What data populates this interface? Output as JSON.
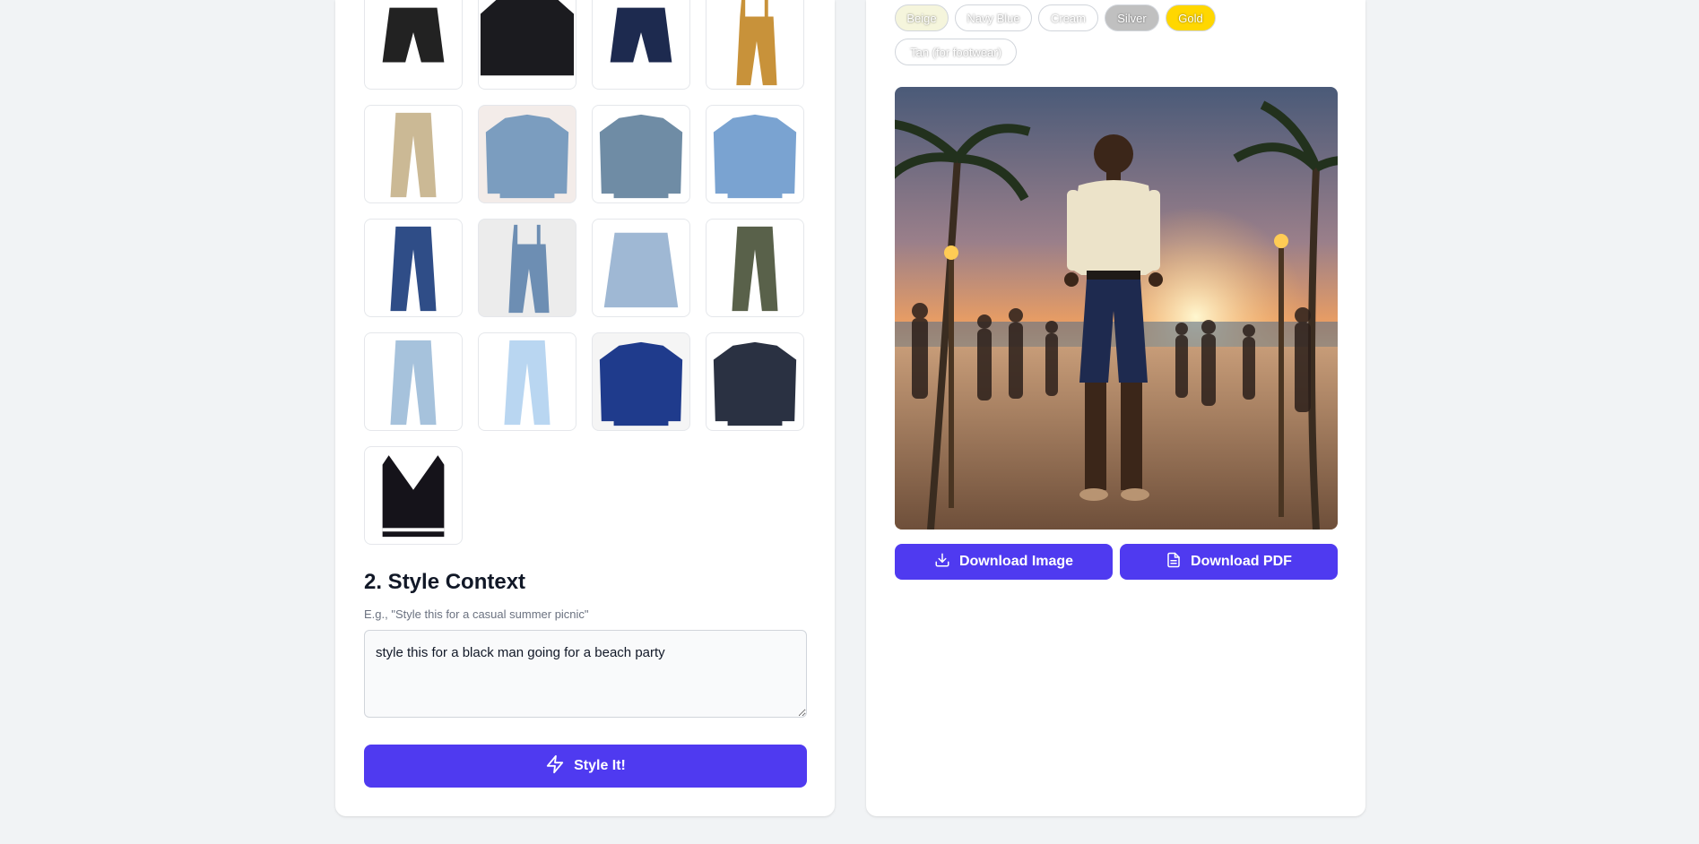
{
  "wardrobe": {
    "items": [
      {
        "name": "Black shorts",
        "kind": "shorts",
        "color": "#222222",
        "bg": "#ffffff"
      },
      {
        "name": "Black sweatshirt",
        "kind": "top",
        "color": "#1b1b1f",
        "bg": "#ffffff"
      },
      {
        "name": "Navy cargo shorts",
        "kind": "shorts",
        "color": "#1d2a4f",
        "bg": "#ffffff"
      },
      {
        "name": "Tan overalls",
        "kind": "overalls",
        "color": "#c8923a",
        "bg": "#ffffff"
      },
      {
        "name": "Beige cargo pants",
        "kind": "pants",
        "color": "#cbb995",
        "bg": "#ffffff"
      },
      {
        "name": "Cropped denim jacket",
        "kind": "jacket",
        "color": "#7b9dbf",
        "bg": "#f3ece9"
      },
      {
        "name": "Patched denim jacket",
        "kind": "jacket",
        "color": "#6f8ca5",
        "bg": "#ffffff"
      },
      {
        "name": "Light denim jacket",
        "kind": "jacket",
        "color": "#7aa3d1",
        "bg": "#ffffff"
      },
      {
        "name": "Dark blue jeans",
        "kind": "pants",
        "color": "#2f4d87",
        "bg": "#ffffff"
      },
      {
        "name": "Denim overalls",
        "kind": "overalls",
        "color": "#6d8eb3",
        "bg": "#ececec"
      },
      {
        "name": "Denim skirt",
        "kind": "skirt",
        "color": "#9fb8d4",
        "bg": "#ffffff"
      },
      {
        "name": "Olive cargo pants",
        "kind": "pants",
        "color": "#59614a",
        "bg": "#ffffff"
      },
      {
        "name": "Light wash jeans",
        "kind": "pants",
        "color": "#a6c2dc",
        "bg": "#ffffff"
      },
      {
        "name": "Sky blue jeans",
        "kind": "pants",
        "color": "#b9d6f1",
        "bg": "#ffffff"
      },
      {
        "name": "Track jacket",
        "kind": "jacket",
        "color": "#1f3b8c",
        "bg": "#f5f5f5"
      },
      {
        "name": "Navy bomber jacket",
        "kind": "jacket",
        "color": "#2a3142",
        "bg": "#ffffff"
      },
      {
        "name": "Sweater vest",
        "kind": "vest",
        "color": "#15131a",
        "bg": "#ffffff"
      }
    ]
  },
  "context": {
    "title": "2. Style Context",
    "hint": "E.g., \"Style this for a casual summer picnic\"",
    "value": "style this for a black man going for a beach party"
  },
  "actions": {
    "style_label": "Style It!",
    "download_image_label": "Download Image",
    "download_pdf_label": "Download PDF",
    "accent": "#4f3af0"
  },
  "palette": {
    "colors": [
      {
        "label": "Beige",
        "hex": "#f5f5dc"
      },
      {
        "label": "Navy Blue",
        "hex": "#ffffff"
      },
      {
        "label": "Cream",
        "hex": "#ffffff"
      },
      {
        "label": "Silver",
        "hex": "#c0c0c0"
      },
      {
        "label": "Gold",
        "hex": "#ffd700"
      },
      {
        "label": "Tan (for footwear)",
        "hex": "#ffffff"
      }
    ]
  },
  "result": {
    "image_icon": "beach-party-outfit-image"
  }
}
